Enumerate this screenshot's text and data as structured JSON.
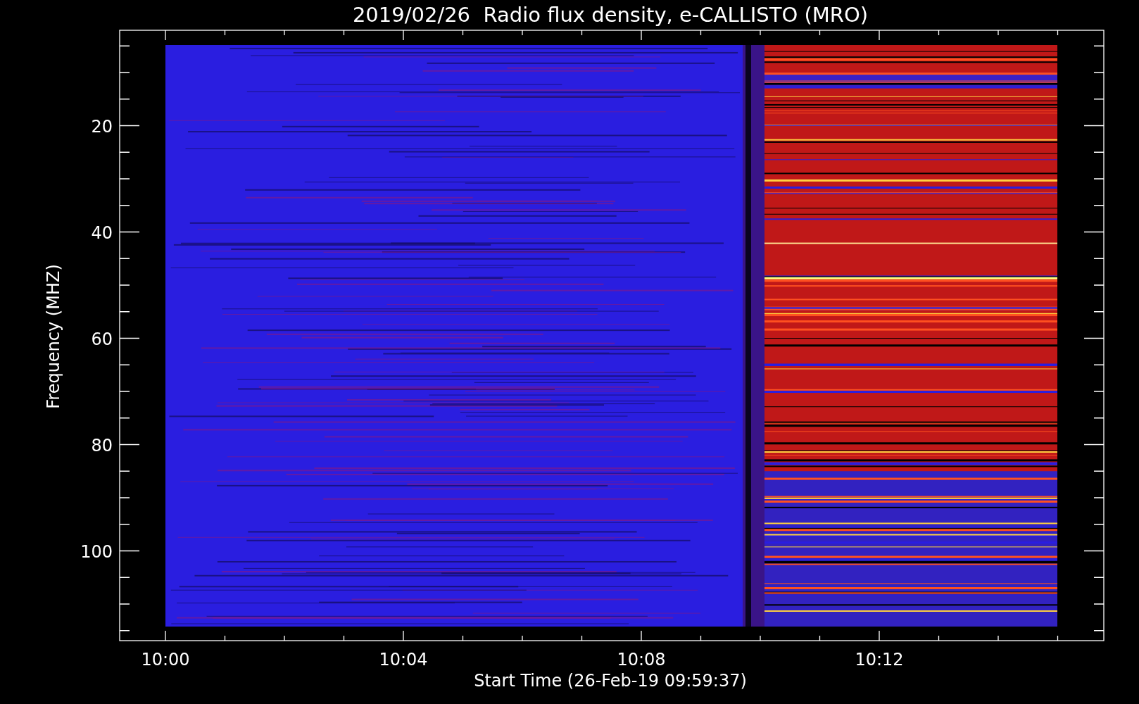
{
  "plot": {
    "title": "2019/02/26  Radio flux density, e-CALLISTO (MRO)",
    "x_axis": {
      "label": "Start Time (26-Feb-19 09:59:37)",
      "ticks": [
        "10:00",
        "10:04",
        "10:08",
        "10:12"
      ]
    },
    "y_axis": {
      "label": "Frequency (MHZ)",
      "ticks": [
        "20",
        "40",
        "60",
        "80",
        "100"
      ]
    }
  }
}
